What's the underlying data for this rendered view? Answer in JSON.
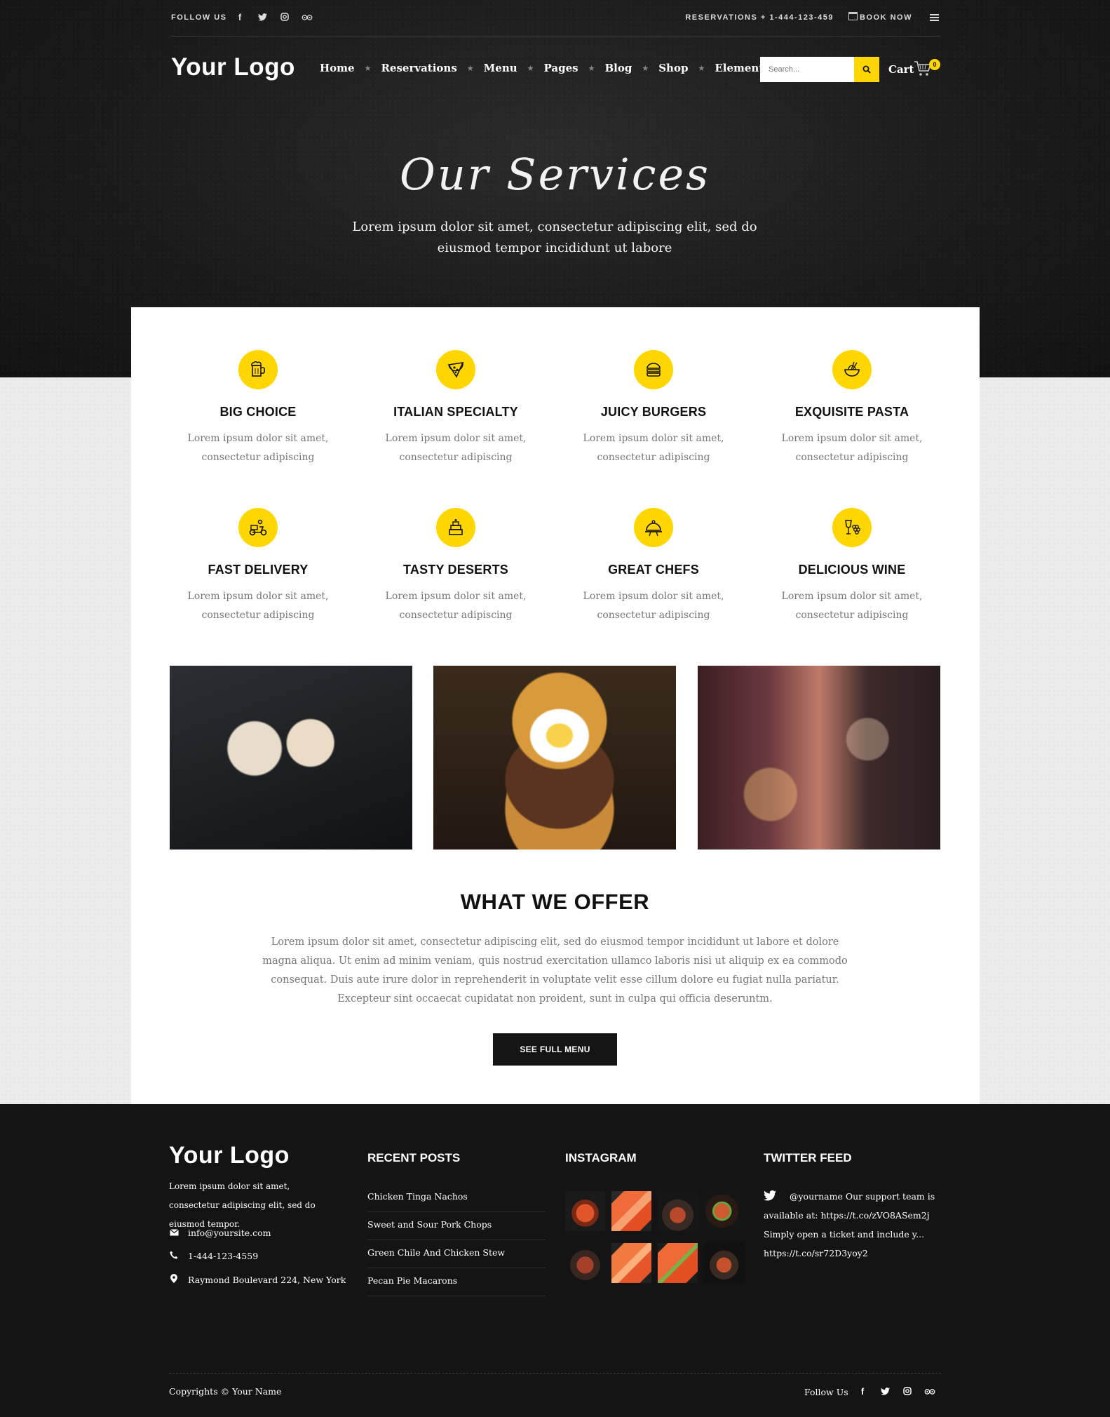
{
  "topbar": {
    "follow_label": "FOLLOW US",
    "social_icons": [
      "facebook-icon",
      "twitter-icon",
      "instagram-icon",
      "tripadvisor-icon"
    ],
    "reservations": "RESERVATIONS + 1-444-123-459",
    "book_now": "BOOK NOW"
  },
  "header": {
    "logo": "Your Logo",
    "nav": [
      "Home",
      "Reservations",
      "Menu",
      "Pages",
      "Blog",
      "Shop",
      "Elements"
    ],
    "search_placeholder": "Search...",
    "cart_label": "Cart",
    "cart_count": "0"
  },
  "hero": {
    "title": "Our Services",
    "subtitle": "Lorem ipsum dolor sit amet, consectetur adipiscing elit, sed do eiusmod tempor incididunt ut labore"
  },
  "services": [
    {
      "title": "BIG CHOICE",
      "desc": "Lorem ipsum dolor sit amet, consectetur adipiscing",
      "icon": "beer-mug-icon"
    },
    {
      "title": "ITALIAN SPECIALTY",
      "desc": "Lorem ipsum dolor sit amet, consectetur adipiscing",
      "icon": "pizza-slice-icon"
    },
    {
      "title": "JUICY BURGERS",
      "desc": "Lorem ipsum dolor sit amet, consectetur adipiscing",
      "icon": "burger-icon"
    },
    {
      "title": "EXQUISITE PASTA",
      "desc": "Lorem ipsum dolor sit amet, consectetur adipiscing",
      "icon": "noodle-bowl-icon"
    },
    {
      "title": "FAST DELIVERY",
      "desc": "Lorem ipsum dolor sit amet, consectetur adipiscing",
      "icon": "delivery-scooter-icon"
    },
    {
      "title": "TASTY DESERTS",
      "desc": "Lorem ipsum dolor sit amet, consectetur adipiscing",
      "icon": "cake-icon"
    },
    {
      "title": "GREAT CHEFS",
      "desc": "Lorem ipsum dolor sit amet, consectetur adipiscing",
      "icon": "cloche-icon"
    },
    {
      "title": "DELICIOUS WINE",
      "desc": "Lorem ipsum dolor sit amet, consectetur adipiscing",
      "icon": "wine-grapes-icon"
    }
  ],
  "offer": {
    "title": "WHAT WE OFFER",
    "text": "Lorem ipsum dolor sit amet, consectetur adipiscing elit, sed do eiusmod tempor incididunt ut labore et dolore magna aliqua. Ut enim ad minim veniam, quis nostrud exercitation ullamco laboris nisi ut aliquip ex ea commodo consequat. Duis aute irure dolor in reprehenderit in voluptate velit esse cillum dolore eu fugiat nulla pariatur. Excepteur sint occaecat cupidatat non proident, sunt in culpa qui officia deseruntm.",
    "button": "SEE FULL MENU"
  },
  "footer": {
    "logo": "Your Logo",
    "about": "Lorem ipsum dolor sit amet, consectetur adipiscing elit, sed do eiusmod tempor.",
    "email": "info@yoursite.com",
    "phone": "1-444-123-4559",
    "address": "Raymond Boulevard 224, New York",
    "recent_posts_title": "RECENT POSTS",
    "posts": [
      "Chicken Tinga Nachos",
      "Sweet and Sour Pork Chops",
      "Green Chile And Chicken Stew",
      "Pecan Pie Macarons"
    ],
    "instagram_title": "INSTAGRAM",
    "twitter_title": "TWITTER FEED",
    "tweet": "@yourname  Our support team is available at: https://t.co/zVO8ASem2j Simply open a ticket and include y... https://t.co/sr72D3yoy2",
    "copyright": "Copyrights © Your Name",
    "follow_label": "Follow Us"
  },
  "colors": {
    "accent": "#ffd600",
    "dark": "#141414",
    "card": "#ffffff"
  }
}
